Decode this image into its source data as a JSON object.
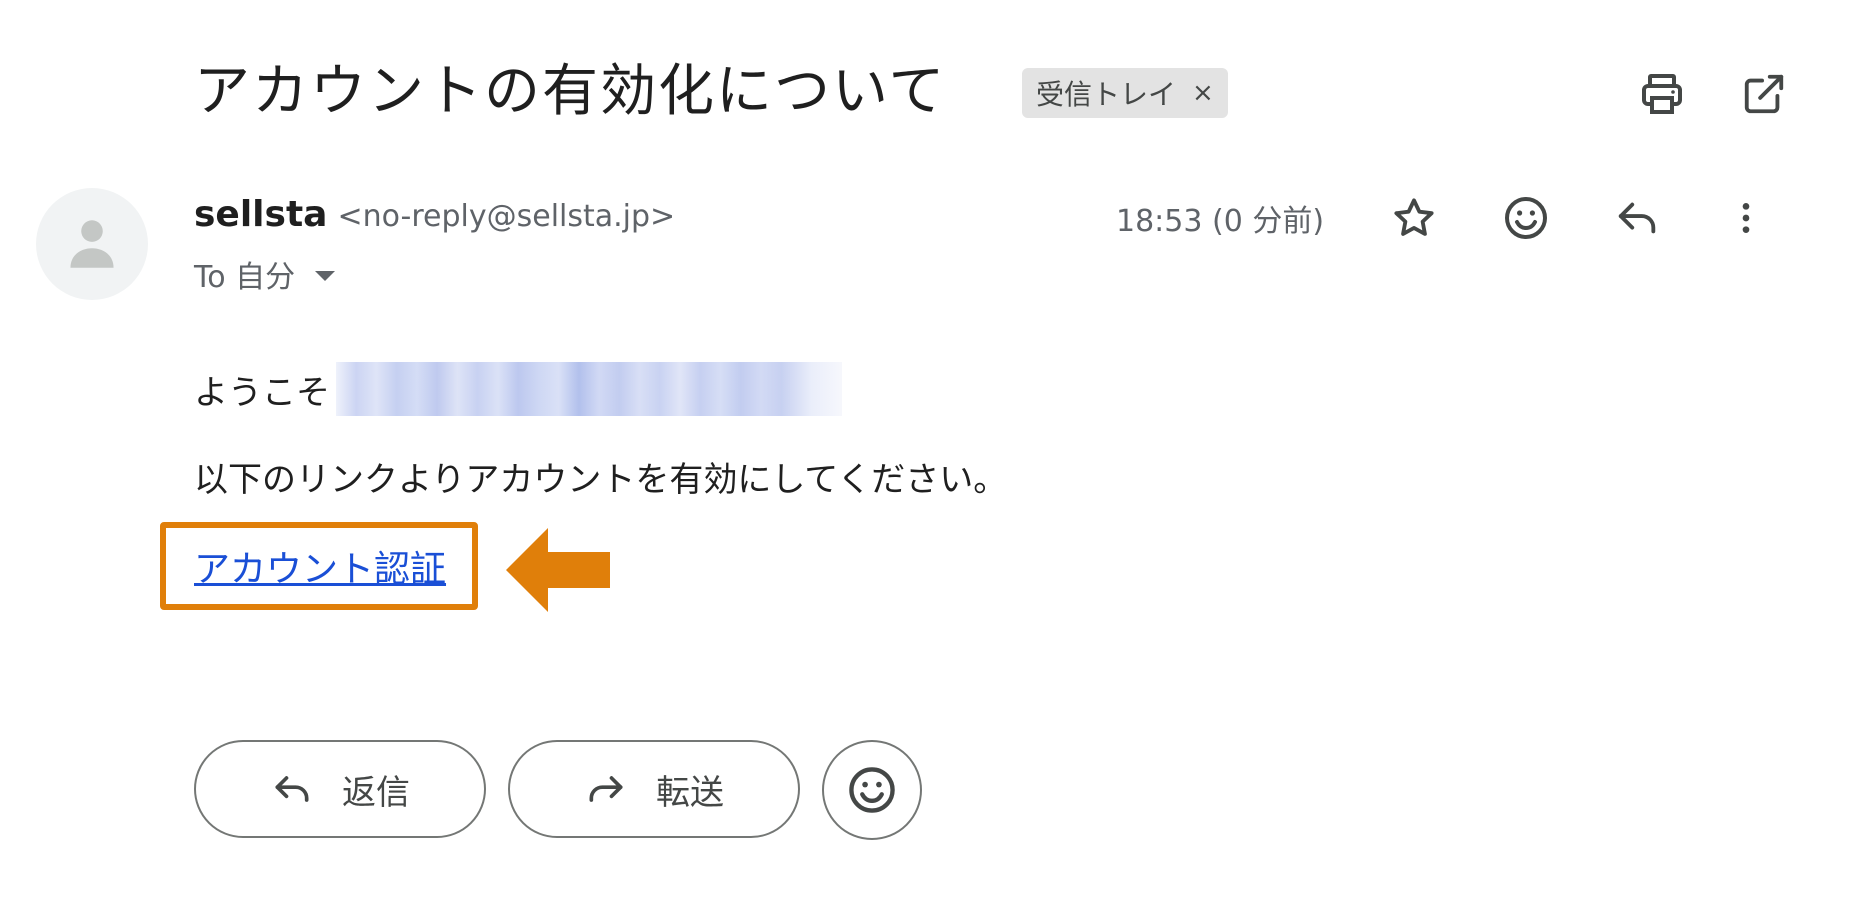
{
  "email": {
    "subject": "アカウントの有効化について",
    "label": "受信トレイ",
    "label_remove": "×",
    "sender_name": "sellsta",
    "sender_email": "<no-reply@sellsta.jp>",
    "to": "To 自分",
    "timestamp": "18:53 (0 分前)"
  },
  "body": {
    "greeting": "ようこそ",
    "instruction": "以下のリンクよりアカウントを有効にしてください。",
    "link_text": "アカウント認証"
  },
  "actions": {
    "reply_label": "返信",
    "forward_label": "転送"
  },
  "icons": {
    "print": "print-icon",
    "open_new_window": "open-in-new-icon",
    "star": "star-icon",
    "emoji": "emoji-icon",
    "reply": "reply-icon",
    "more": "more-vert-icon",
    "avatar": "person-icon"
  },
  "colors": {
    "link": "#1a4fd6",
    "highlight": "#e07f0a",
    "label_chip_bg": "#e3e3e3"
  }
}
